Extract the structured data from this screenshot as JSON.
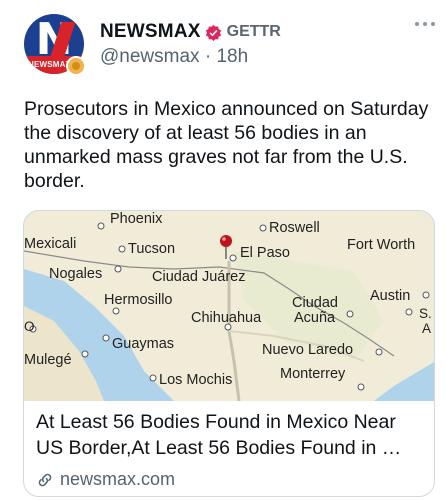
{
  "author": {
    "display_name": "NEWSMAX",
    "platform": "GETTR",
    "handle": "@newsmax",
    "time_ago": "18h",
    "avatar_text": "NEWSMAX",
    "avatar_initial": "N",
    "verified_icon": "verified-badge-icon"
  },
  "post": {
    "text": "Prosecutors in Mexico announced on Saturday the discovery of at least 56 bodies in an unmarked mass graves not far from the U.S. border."
  },
  "link_card": {
    "title": "At Least 56 Bodies Found in Mexico Near US Border,At Least 56 Bodies Found in …",
    "domain": "newsmax.com",
    "map_labels": {
      "phoenix": "Phoenix",
      "roswell": "Roswell",
      "mexicali": "Mexicali",
      "tucson": "Tucson",
      "el_paso": "El Paso",
      "fort_worth": "Fort Worth",
      "nogales": "Nogales",
      "ciudad_juarez": "Ciudad Juárez",
      "hermosillo": "Hermosillo",
      "austin": "Austin",
      "ciudad_acuna_1": "Ciudad",
      "ciudad_acuna_2": "Acuña",
      "chihuahua": "Chihuahua",
      "s_cut": "S.",
      "a_cut": "A",
      "o_cut": "O",
      "guaymas": "Guaymas",
      "nuevo_laredo": "Nuevo Laredo",
      "mulege": "Mulegé",
      "monterrey": "Monterrey",
      "los_mochis": "Los Mochis"
    }
  },
  "colors": {
    "verified": "#e0245e",
    "land": "#f1ecd8",
    "water": "#aed3ea",
    "marker": "#c0141c"
  }
}
